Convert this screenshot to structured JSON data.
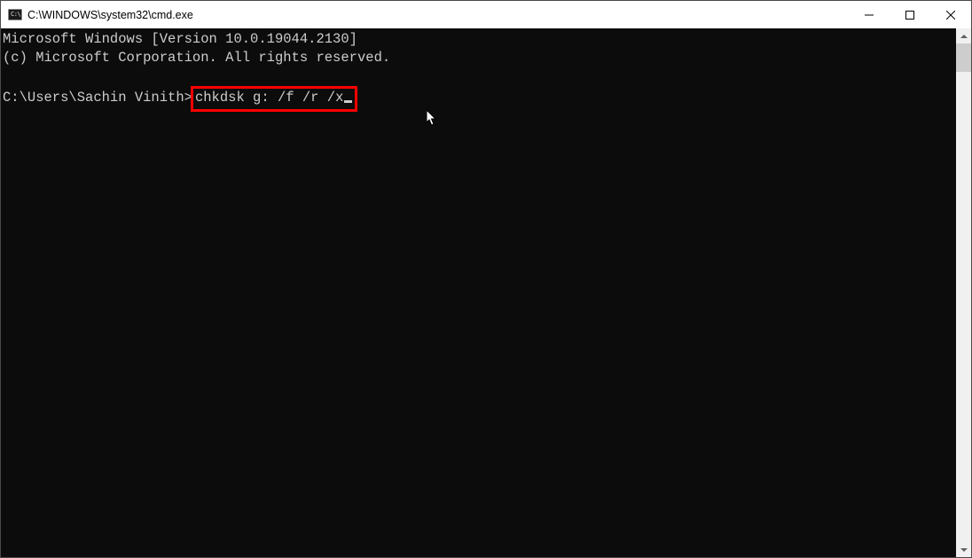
{
  "titlebar": {
    "title": "C:\\WINDOWS\\system32\\cmd.exe",
    "icon_glyph": "C:\\"
  },
  "terminal": {
    "line1": "Microsoft Windows [Version 10.0.19044.2130]",
    "line2": "(c) Microsoft Corporation. All rights reserved.",
    "blank": "",
    "prompt": "C:\\Users\\Sachin Vinith>",
    "command": "chkdsk g: /f /r /x"
  }
}
